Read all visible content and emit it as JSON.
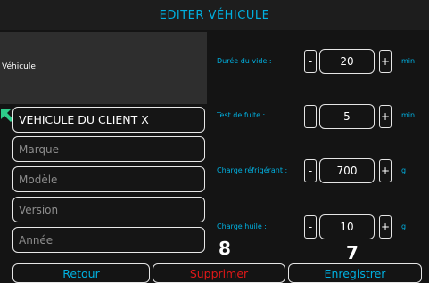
{
  "title": "EDITER VÉHICULE",
  "vehicle_label": "Véhicule",
  "vehicle_fields": [
    {
      "value": "VEHICULE DU CLIENT X",
      "placeholder": ""
    },
    {
      "value": "",
      "placeholder": "Marque"
    },
    {
      "value": "",
      "placeholder": "Modèle"
    },
    {
      "value": "",
      "placeholder": "Version"
    },
    {
      "value": "",
      "placeholder": "Année"
    }
  ],
  "params": [
    {
      "label": "Durée du vide :",
      "value": "20",
      "unit": "min"
    },
    {
      "label": "Test de fuite :",
      "value": "5",
      "unit": "min"
    },
    {
      "label": "Charge réfrigérant :",
      "value": "700",
      "unit": "g"
    },
    {
      "label": "Charge huile :",
      "value": "10",
      "unit": "g"
    }
  ],
  "stepper_minus": "-",
  "stepper_plus": "+",
  "overlay_numbers": {
    "supprimer": "8",
    "enregistrer": "7"
  },
  "buttons": {
    "back": "Retour",
    "delete": "Supprimer",
    "save": "Enregistrer"
  },
  "colors": {
    "accent": "#00b0e0",
    "danger": "#e01818",
    "arrow": "#2ecc8a"
  }
}
